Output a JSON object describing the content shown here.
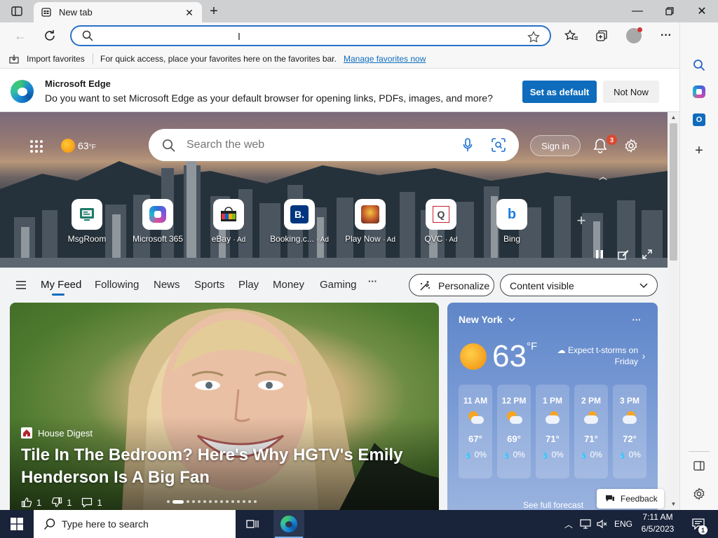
{
  "browser": {
    "tab_title": "New tab",
    "address_placeholder": "",
    "favbar": {
      "import": "Import favorites",
      "hint": "For quick access, place your favorites here on the favorites bar.",
      "manage_link": "Manage favorites now"
    }
  },
  "banner": {
    "title": "Microsoft Edge",
    "message": "Do you want to set Microsoft Edge as your default browser for opening links, PDFs, images, and more?",
    "set_default": "Set as default",
    "not_now": "Not Now"
  },
  "hero": {
    "temperature": "63",
    "temp_unit": "°F",
    "search_placeholder": "Search the web",
    "sign_in": "Sign in",
    "notification_count": "3",
    "tiles": [
      {
        "label": "MsgRoom",
        "ad": ""
      },
      {
        "label": "Microsoft 365",
        "ad": ""
      },
      {
        "label": "eBay",
        "ad": "· Ad"
      },
      {
        "label": "Booking.c...",
        "ad": "· Ad"
      },
      {
        "label": "Play Now",
        "ad": "· Ad"
      },
      {
        "label": "QVC",
        "ad": "· Ad"
      },
      {
        "label": "Bing",
        "ad": ""
      }
    ]
  },
  "feed_nav": {
    "items": [
      "My Feed",
      "Following",
      "News",
      "Sports",
      "Play",
      "Money",
      "Gaming"
    ],
    "more": "···",
    "personalize": "Personalize",
    "content_visible": "Content visible"
  },
  "story": {
    "source": "House Digest",
    "headline_line1": "Tile In The Bedroom? Here's Why HGTV's Emily",
    "headline_line2": "Henderson Is A Big Fan",
    "likes": "1",
    "dislikes": "1",
    "comments": "1"
  },
  "weather": {
    "city": "New York",
    "temp": "63",
    "unit": "°F",
    "forecast_line1": "Expect t-storms on",
    "forecast_line2": "Friday",
    "hours": [
      {
        "time": "11 AM",
        "temp": "67°",
        "precip": "0%"
      },
      {
        "time": "12 PM",
        "temp": "69°",
        "precip": "0%"
      },
      {
        "time": "1 PM",
        "temp": "71°",
        "precip": "0%"
      },
      {
        "time": "2 PM",
        "temp": "71°",
        "precip": "0%"
      },
      {
        "time": "3 PM",
        "temp": "72°",
        "precip": "0%"
      }
    ],
    "full_forecast": "See full forecast",
    "feedback": "Feedback"
  },
  "taskbar": {
    "search_placeholder": "Type here to search",
    "language": "ENG",
    "time": "7:11 AM",
    "date": "6/5/2023",
    "notification_count": "1"
  },
  "colors": {
    "accent": "#0f6cbd",
    "address_border": "#2a70c8",
    "taskbar": "#19233a"
  }
}
